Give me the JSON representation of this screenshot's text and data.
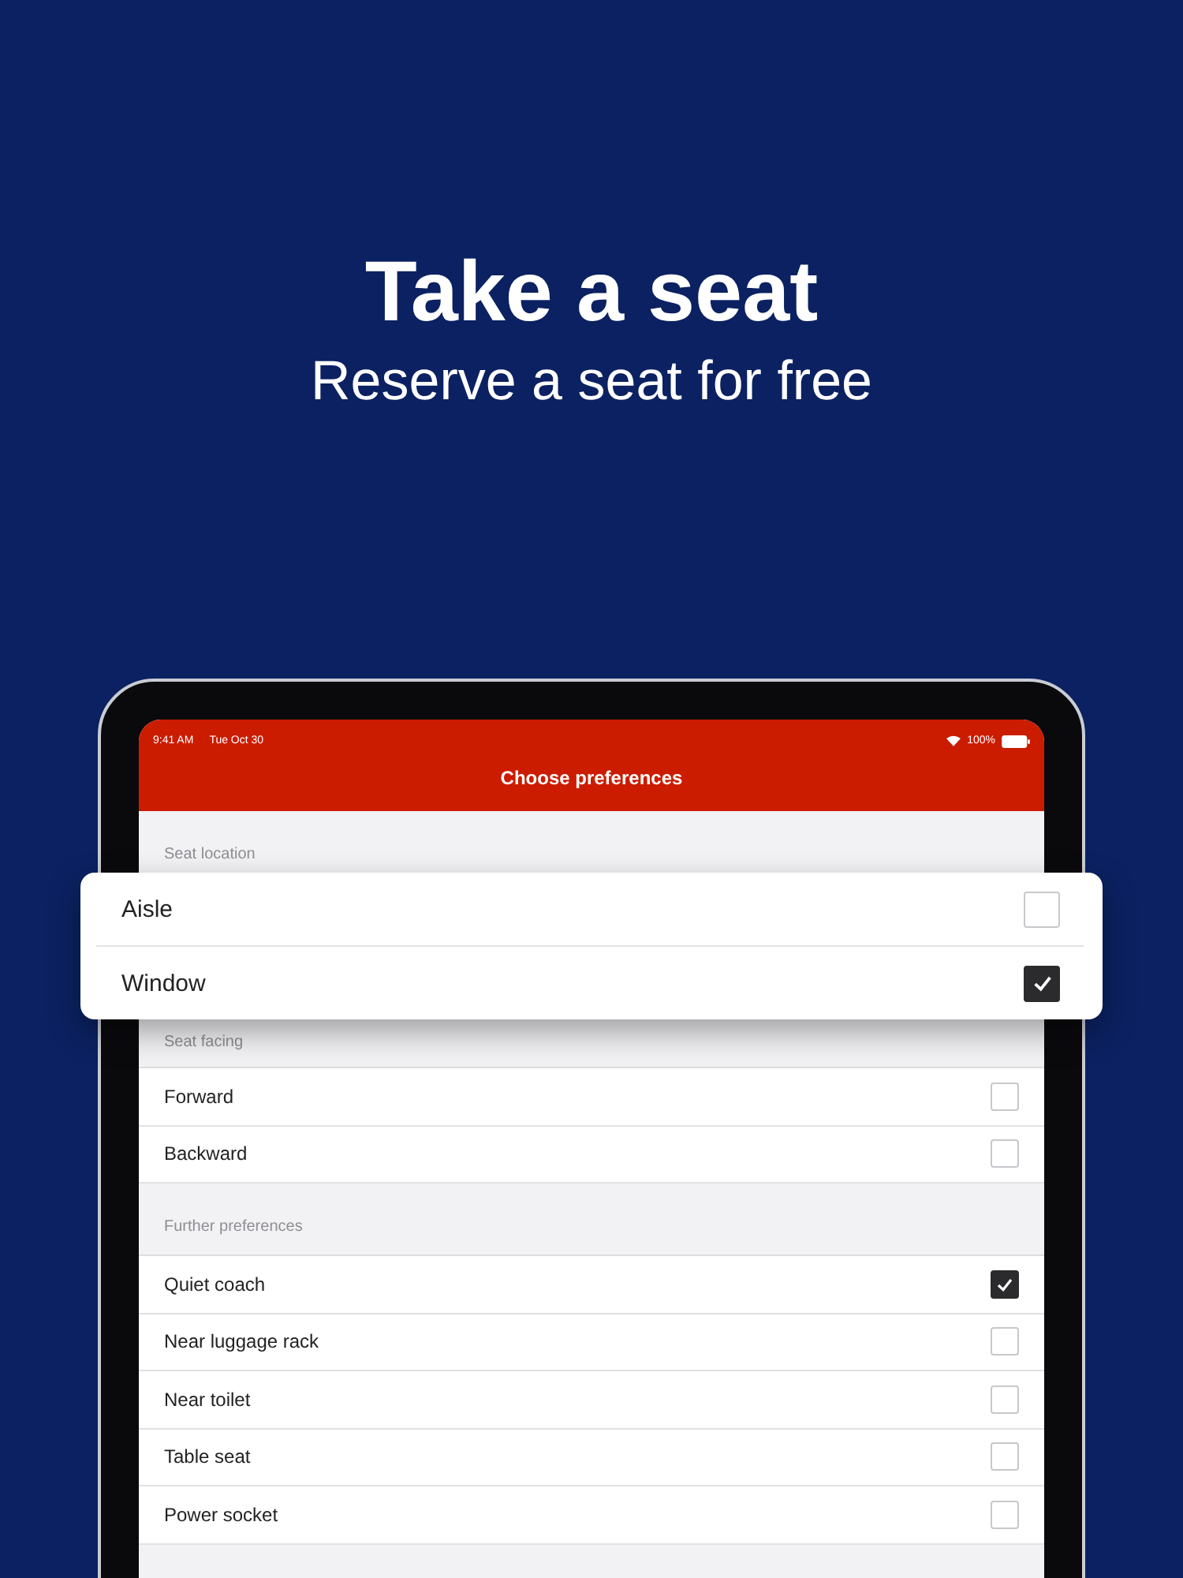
{
  "headline": "Take a seat",
  "subheadline": "Reserve a seat for free",
  "status_bar": {
    "time": "9:41 AM",
    "date": "Tue Oct 30",
    "battery": "100%"
  },
  "nav_title": "Choose preferences",
  "first_section_header": "Seat location",
  "popup_options": [
    {
      "label": "Aisle",
      "checked": false
    },
    {
      "label": "Window",
      "checked": true
    }
  ],
  "sections": [
    {
      "header": "Seat facing",
      "options": [
        {
          "label": "Forward",
          "checked": false
        },
        {
          "label": "Backward",
          "checked": false
        }
      ]
    },
    {
      "header": "Further preferences",
      "options": [
        {
          "label": "Quiet coach",
          "checked": true
        },
        {
          "label": "Near luggage rack",
          "checked": false
        },
        {
          "label": "Near toilet",
          "checked": false
        },
        {
          "label": "Table seat",
          "checked": false
        },
        {
          "label": "Power socket",
          "checked": false
        }
      ]
    }
  ]
}
